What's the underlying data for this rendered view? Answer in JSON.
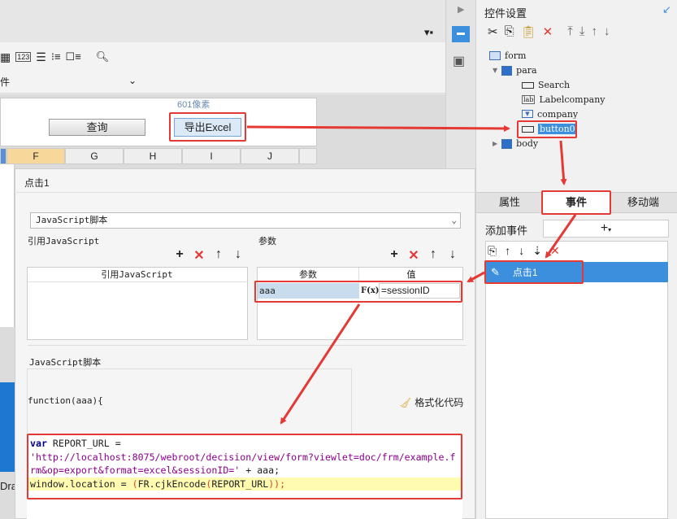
{
  "designer": {
    "toolbar_dropdown_text": "件",
    "ruler_label": "601像素",
    "query_button": "查询",
    "export_button": "导出Excel",
    "columns": [
      "F",
      "G",
      "H",
      "I",
      "J"
    ],
    "partial_text": "Dra",
    "icon_123": "123"
  },
  "right_panel": {
    "title": "控件设置",
    "tree": {
      "form": "form",
      "para": "para",
      "search": "Search",
      "labelcompany": "Labelcompany",
      "company": "company",
      "button0": "button0",
      "body": "body",
      "lab_tag": "lab"
    },
    "tabs": [
      "属性",
      "事件",
      "移动端"
    ],
    "add_event_label": "添加事件",
    "event_item": "点击1"
  },
  "dialog": {
    "title": "点击1",
    "script_type": "JavaScript脚本",
    "ref_js_label": "引用JavaScript",
    "ref_js_header": "引用JavaScript",
    "params_label": "参数",
    "param_col_name": "参数",
    "param_col_value": "值",
    "param_name": "aaa",
    "param_formula_icon": "F(x)",
    "param_value": "=sessionID",
    "script_section_label": "JavaScript脚本",
    "function_signature": "function(aaa){",
    "format_code": "格式化代码",
    "code": {
      "line1_kw": "var",
      "line1_rest": " REPORT_URL =",
      "line2": "'http://localhost:8075/webroot/decision/view/form?viewlet=doc/frm/example.f",
      "line3_str": "rm&op=export&format=excel&sessionID='",
      "line3_rest": " + aaa;",
      "line4_a": "window.location = ",
      "line4_b": "(",
      "line4_c": "FR.cjkEncode",
      "line4_d": "(",
      "line4_e": "REPORT_URL",
      "line4_f": "));"
    }
  },
  "colors": {
    "highlight_red": "#e53935",
    "selection_blue": "#3b8fdc",
    "code_highlight": "#fffbb0",
    "keyword_blue": "#00008b",
    "string_purple": "#8b008b"
  }
}
